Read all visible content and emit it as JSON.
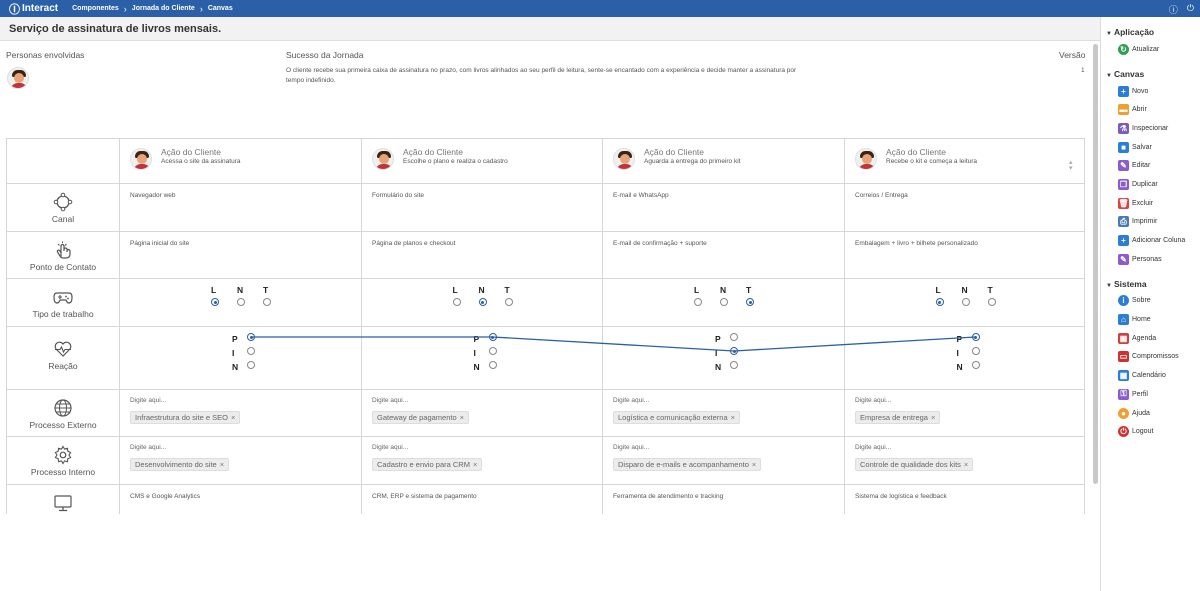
{
  "topbar": {
    "app_name": "Interact",
    "breadcrumbs": [
      "Componentes",
      "Jornada do Cliente",
      "Canvas"
    ]
  },
  "page_title": "Serviço de assinatura de livros mensais.",
  "meta": {
    "personas_label": "Personas envolvidas",
    "success_label": "Sucesso da Jornada",
    "success_text": "O cliente recebe sua primeira caixa de assinatura no prazo, com livros alinhados ao seu perfil de leitura, sente-se encantado com a experiência e decide manter a assinatura por tempo indefinido.",
    "version_label": "Versão",
    "version_value": "1"
  },
  "rows": {
    "canal": "Canal",
    "ponto": "Ponto de Contato",
    "tipo": "Tipo de trabalho",
    "reacao": "Reação",
    "externo": "Processo Externo",
    "interno": "Processo Interno"
  },
  "work_letters": [
    "L",
    "N",
    "T"
  ],
  "reaction_letters": [
    "P",
    "I",
    "N"
  ],
  "placeholder": "Digite aqui...",
  "columns": [
    {
      "title": "Ação do Cliente",
      "subtitle": "Acessa o site da assinatura",
      "canal": "Navegador web",
      "ponto": "Página inicial do site",
      "work_selected": "L",
      "reaction": "P",
      "externo": "Infraestrutura do site e SEO",
      "interno": "Desenvolvimento do site",
      "sistema": "CMS e Google Analytics"
    },
    {
      "title": "Ação do Cliente",
      "subtitle": "Escolhe o plano e realiza o cadastro",
      "canal": "Formulário do site",
      "ponto": "Página de planos e checkout",
      "work_selected": "N",
      "reaction": "P",
      "externo": "Gateway de pagamento",
      "interno": "Cadastro e envio para CRM",
      "sistema": "CRM, ERP e sistema de pagamento"
    },
    {
      "title": "Ação do Cliente",
      "subtitle": "Aguarda a entrega do primeiro kit",
      "canal": "E-mail e WhatsApp",
      "ponto": "E-mail de confirmação + suporte",
      "work_selected": "T",
      "reaction": "I",
      "externo": "Logística e comunicação externa",
      "interno": "Disparo de e-mails e acompanhamento",
      "sistema": "Ferramenta de atendimento e tracking"
    },
    {
      "title": "Ação do Cliente",
      "subtitle": "Recebe o kit e começa a leitura",
      "canal": "Correios / Entrega",
      "ponto": "Embalagem + livro + bilhete personalizado",
      "work_selected": "L",
      "reaction": "P",
      "externo": "Empresa de entrega",
      "interno": "Controle de qualidade dos kits",
      "sistema": "Sistema de logística e feedback"
    }
  ],
  "sidebar": {
    "sections": [
      {
        "title": "Aplicação",
        "items": [
          {
            "label": "Atualizar",
            "icon": "refresh-icon",
            "color": "#2e9e4f"
          }
        ]
      },
      {
        "title": "Canvas",
        "items": [
          {
            "label": "Novo",
            "icon": "plus-icon",
            "color": "#2b7ed8"
          },
          {
            "label": "Abrir",
            "icon": "folder-icon",
            "color": "#f0a030"
          },
          {
            "label": "Inspecionar",
            "icon": "flask-icon",
            "color": "#7a5cc0"
          },
          {
            "label": "Salvar",
            "icon": "save-icon",
            "color": "#2b7ed8"
          },
          {
            "label": "Editar",
            "icon": "pencil-icon",
            "color": "#8a5cd0"
          },
          {
            "label": "Duplicar",
            "icon": "copy-icon",
            "color": "#8a5cd0"
          },
          {
            "label": "Excluir",
            "icon": "trash-icon",
            "color": "#e04040"
          },
          {
            "label": "Imprimir",
            "icon": "printer-icon",
            "color": "#4a7ab8"
          },
          {
            "label": "Adicionar Coluna",
            "icon": "add-column-icon",
            "color": "#2b7ed8"
          },
          {
            "label": "Personas",
            "icon": "pencil-icon",
            "color": "#8a5cd0"
          }
        ]
      },
      {
        "title": "Sistema",
        "items": [
          {
            "label": "Sobre",
            "icon": "info-icon",
            "color": "#2b7ed8"
          },
          {
            "label": "Home",
            "icon": "home-icon",
            "color": "#2b7ed8"
          },
          {
            "label": "Agenda",
            "icon": "agenda-icon",
            "color": "#d04040"
          },
          {
            "label": "Compromissos",
            "icon": "briefcase-icon",
            "color": "#d03030"
          },
          {
            "label": "Calendário",
            "icon": "calendar-icon",
            "color": "#2b7ed8"
          },
          {
            "label": "Perfil",
            "icon": "key-icon",
            "color": "#8a5cd0"
          },
          {
            "label": "Ajuda",
            "icon": "lightbulb-icon",
            "color": "#f0a030"
          },
          {
            "label": "Logout",
            "icon": "power-icon",
            "color": "#d03030"
          }
        ]
      }
    ]
  }
}
